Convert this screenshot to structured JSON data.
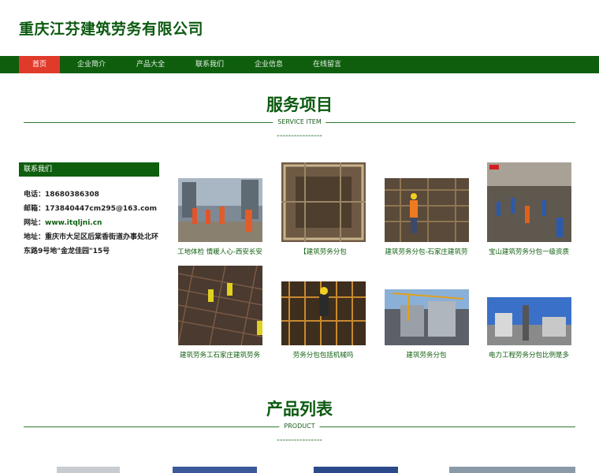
{
  "site": {
    "title": "重庆江芬建筑劳务有限公司"
  },
  "nav": {
    "items": [
      {
        "label": "首页",
        "active": true
      },
      {
        "label": "企业简介"
      },
      {
        "label": "产品大全"
      },
      {
        "label": "联系我们"
      },
      {
        "label": "企业信息"
      },
      {
        "label": "在线留言"
      }
    ]
  },
  "services": {
    "title": "服务项目",
    "subtitle": "SERVICE ITEM",
    "dashes": "----------------"
  },
  "contact": {
    "heading": "联系我们",
    "phone_label": "电话：",
    "phone": "18680386308",
    "email_label": "邮箱：",
    "email": "173840447cm295@163.com",
    "web_label": "网址：",
    "web": "www.itqljni.cn",
    "address_label": "地址：",
    "address": "重庆市大足区后棠香街道办事处北环东路9号地\"金龙佳园\"15号"
  },
  "cards": [
    {
      "caption": "工地体检 情暖人心-西安长安"
    },
    {
      "caption": "【建筑劳务分包"
    },
    {
      "caption": "建筑劳务分包-石家庄建筑劳"
    },
    {
      "caption": "宝山建筑劳务分包一级资质"
    },
    {
      "caption": "建筑劳务工石家庄建筑劳务"
    },
    {
      "caption": "劳务分包包括机械吗"
    },
    {
      "caption": "建筑劳务分包"
    },
    {
      "caption": "电力工程劳务分包比例是多"
    }
  ],
  "products": {
    "title": "产品列表",
    "subtitle": "PRODUCT",
    "dashes": "----------------"
  },
  "colors": {
    "brand": "#0e5e0e",
    "accent": "#e03a2a"
  }
}
